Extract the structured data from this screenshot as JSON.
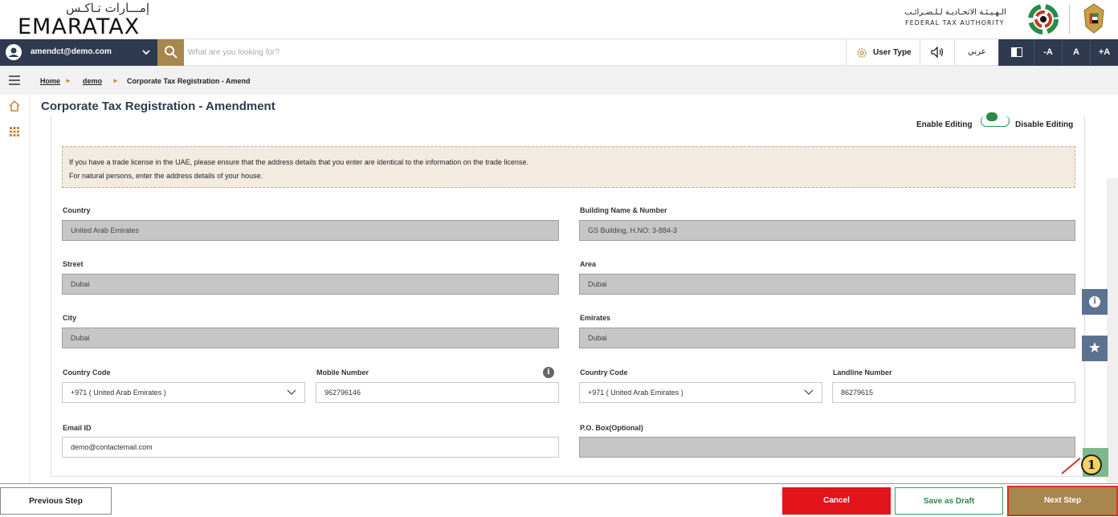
{
  "header": {
    "logo_arabic": "إمـــارات تـاكـس",
    "logo_english": "EMARATAX",
    "authority_arabic": "الـهـيـئـة الاتحـاديـة لـلـضـرائـب",
    "authority_english": "FEDERAL TAX AUTHORITY"
  },
  "topbar": {
    "user_email": "amendct@demo.com",
    "search_placeholder": "What are you looking for?",
    "user_type_label": "User Type",
    "language_label": "عربي",
    "font_decrease": "-A",
    "font_normal": "A",
    "font_increase": "+A"
  },
  "breadcrumb": {
    "home": "Home",
    "demo": "demo",
    "current": "Corporate Tax Registration - Amend"
  },
  "page": {
    "title": "Corporate Tax Registration - Amendment",
    "enable_editing": "Enable Editing",
    "disable_editing": "Disable Editing",
    "notice_line1": "If you have a trade license in the UAE, please ensure that the address details that you enter are identical to the information on the trade license.",
    "notice_line2": "For natural persons, enter the address details of your house."
  },
  "form": {
    "country": {
      "label": "Country",
      "value": "United Arab Emirates"
    },
    "building": {
      "label": "Building Name & Number",
      "value": "GS Building, H.NO: 3-884-3"
    },
    "street": {
      "label": "Street",
      "value": "Dubai"
    },
    "area": {
      "label": "Area",
      "value": "Dubai"
    },
    "city": {
      "label": "City",
      "value": "Dubai"
    },
    "emirates": {
      "label": "Emirates",
      "value": "Dubai"
    },
    "mobile_country_code": {
      "label": "Country Code",
      "value": "+971 ( United Arab Emirates )"
    },
    "mobile_number": {
      "label": "Mobile Number",
      "value": "962796146"
    },
    "landline_country_code": {
      "label": "Country Code",
      "value": "+971 ( United Arab Emirates )"
    },
    "landline_number": {
      "label": "Landline Number",
      "value": "86279615"
    },
    "email": {
      "label": "Email ID",
      "value": "demo@contactemail.com"
    },
    "po_box": {
      "label": "P.O. Box(Optional)",
      "value": ""
    }
  },
  "footer": {
    "previous": "Previous Step",
    "cancel": "Cancel",
    "save_draft": "Save as Draft",
    "next": "Next Step"
  },
  "callout_number": "1",
  "colors": {
    "navy": "#2f3a50",
    "gold": "#a8874f",
    "cancel_red": "#e3141b",
    "green": "#2a8a4a"
  }
}
